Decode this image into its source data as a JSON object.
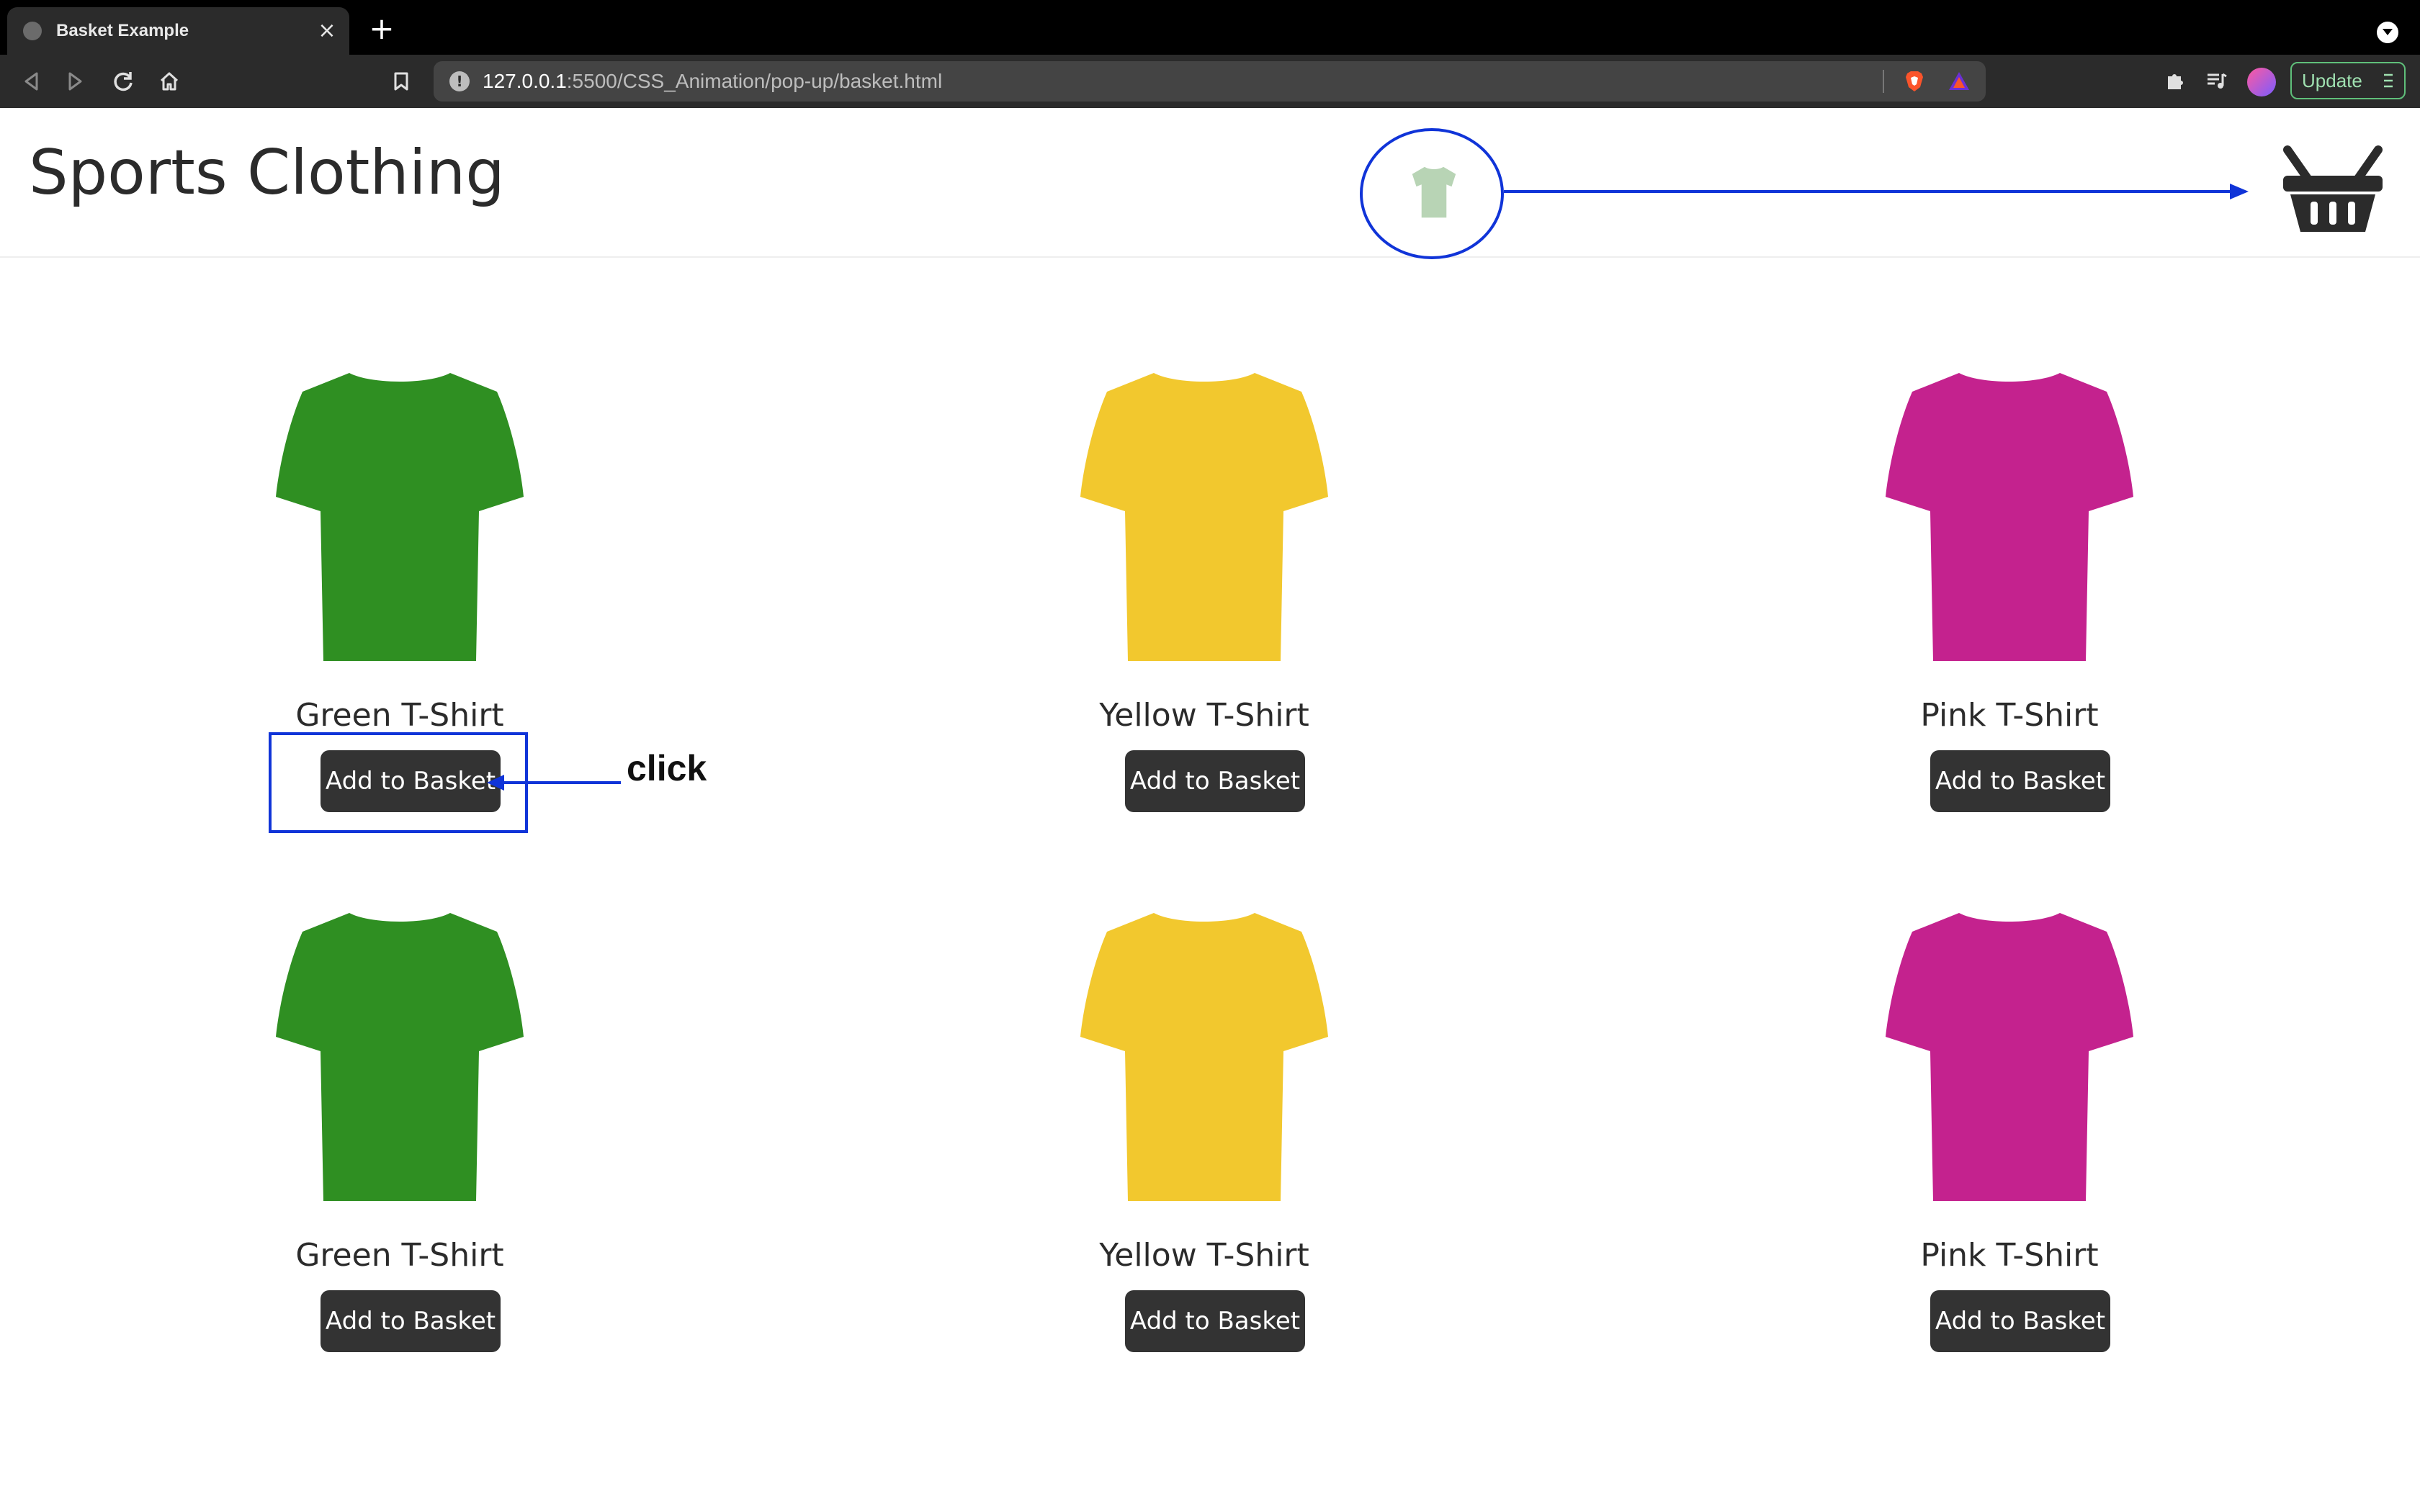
{
  "browser": {
    "tab_title": "Basket Example",
    "tab_close": "×",
    "new_tab": "+",
    "url_host": "127.0.0.1",
    "url_rest": ":5500/CSS_Animation/pop-up/basket.html",
    "info_glyph": "!",
    "update_label": "Update",
    "icons": {
      "back": "back-arrow-icon",
      "forward": "forward-arrow-icon",
      "reload": "reload-icon",
      "home": "home-icon",
      "bookmark": "bookmark-icon",
      "shields": "brave-shields-icon",
      "rewards": "brave-rewards-icon",
      "extensions": "puzzle-icon",
      "playlist": "playlist-icon"
    }
  },
  "site": {
    "title": "Sports Clothing",
    "basket_icon": "basket-icon"
  },
  "products": [
    {
      "name": "Green T-Shirt",
      "button": "Add to Basket",
      "color": "#2f8f22"
    },
    {
      "name": "Yellow T-Shirt",
      "button": "Add to Basket",
      "color": "#f2c82e"
    },
    {
      "name": "Pink T-Shirt",
      "button": "Add to Basket",
      "color": "#c4228e"
    },
    {
      "name": "Green T-Shirt",
      "button": "Add to Basket",
      "color": "#2f8f22"
    },
    {
      "name": "Yellow T-Shirt",
      "button": "Add to Basket",
      "color": "#f2c82e"
    },
    {
      "name": "Pink T-Shirt",
      "button": "Add to Basket",
      "color": "#c4228e"
    }
  ],
  "annotations": {
    "click_label": "click",
    "annotation_color": "#1034d8",
    "flying_item_color": "#7fb27a"
  }
}
